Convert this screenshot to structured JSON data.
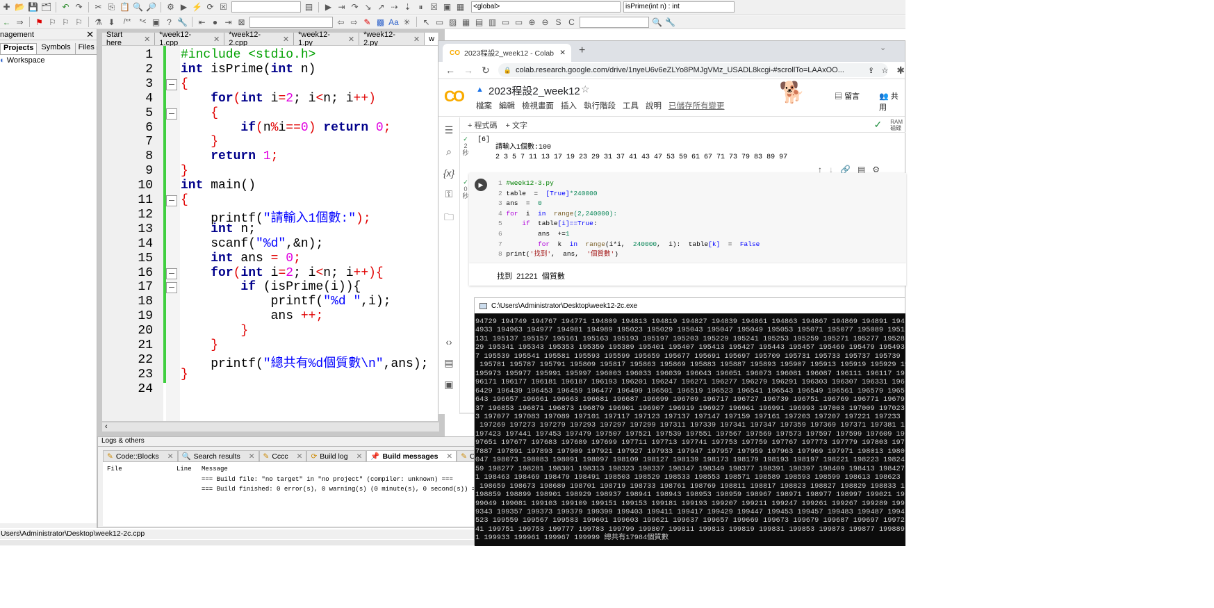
{
  "toolbar": {
    "scope_combo": "<global>",
    "function_combo": "isPrime(int n) : int"
  },
  "management": {
    "title": "nagement",
    "tabs": [
      "Projects",
      "Symbols",
      "Files"
    ],
    "tree_root": "Workspace"
  },
  "editor": {
    "tabs": [
      "Start here",
      "*week12-1.cpp",
      "*week12-2.cpp",
      "*week12-1.py",
      "*week12-2.py",
      "w"
    ],
    "lines": [
      [
        [
          "#include <stdio.h>",
          "pp"
        ]
      ],
      [
        [
          "int",
          "kw"
        ],
        [
          " isPrime(",
          "tx"
        ],
        [
          "int",
          "kw"
        ],
        [
          " n)",
          "tx"
        ]
      ],
      [
        [
          "{",
          "op"
        ]
      ],
      [
        [
          "    ",
          "tx"
        ],
        [
          "for",
          "kw"
        ],
        [
          "(",
          "op"
        ],
        [
          "int",
          "kw"
        ],
        [
          " i",
          "tx"
        ],
        [
          "=",
          "op"
        ],
        [
          "2",
          "nu"
        ],
        [
          "; i",
          "tx"
        ],
        [
          "<",
          "op"
        ],
        [
          "n; i",
          "tx"
        ],
        [
          "++",
          "op"
        ],
        [
          ")",
          "op"
        ]
      ],
      [
        [
          "    {",
          "op"
        ]
      ],
      [
        [
          "        ",
          "tx"
        ],
        [
          "if",
          "kw"
        ],
        [
          "(",
          "op"
        ],
        [
          "n",
          "tx"
        ],
        [
          "%",
          "op"
        ],
        [
          "i",
          "tx"
        ],
        [
          "==",
          "op"
        ],
        [
          "0",
          "nu"
        ],
        [
          ") ",
          "op"
        ],
        [
          "return",
          "kw"
        ],
        [
          " 0",
          "nu"
        ],
        [
          ";",
          "op"
        ]
      ],
      [
        [
          "    }",
          "op"
        ]
      ],
      [
        [
          "    ",
          "tx"
        ],
        [
          "return",
          "kw"
        ],
        [
          " 1",
          "nu"
        ],
        [
          ";",
          "op"
        ]
      ],
      [
        [
          "}",
          "op"
        ]
      ],
      [
        [
          "int",
          "kw"
        ],
        [
          " main()",
          "tx"
        ]
      ],
      [
        [
          "{",
          "op"
        ]
      ],
      [
        [
          "    printf(",
          "tx"
        ],
        [
          "\"請輸入1個數:\"",
          "st"
        ],
        [
          ");",
          "op"
        ]
      ],
      [
        [
          "    ",
          "tx"
        ],
        [
          "int",
          "kw"
        ],
        [
          " n;",
          "tx"
        ]
      ],
      [
        [
          "    scanf(",
          "tx"
        ],
        [
          "\"%d\"",
          "st"
        ],
        [
          ",&n);",
          "tx"
        ]
      ],
      [
        [
          "    ",
          "tx"
        ],
        [
          "int",
          "kw"
        ],
        [
          " ans ",
          "tx"
        ],
        [
          "=",
          "op"
        ],
        [
          " 0",
          "nu"
        ],
        [
          ";",
          "op"
        ]
      ],
      [
        [
          "    ",
          "tx"
        ],
        [
          "for",
          "kw"
        ],
        [
          "(",
          "op"
        ],
        [
          "int",
          "kw"
        ],
        [
          " i",
          "tx"
        ],
        [
          "=",
          "op"
        ],
        [
          "2",
          "nu"
        ],
        [
          "; i",
          "tx"
        ],
        [
          "<",
          "op"
        ],
        [
          "n; i",
          "tx"
        ],
        [
          "++",
          "op"
        ],
        [
          "){",
          "op"
        ]
      ],
      [
        [
          "        ",
          "tx"
        ],
        [
          "if",
          "kw"
        ],
        [
          " (isPrime(i)){",
          "tx"
        ]
      ],
      [
        [
          "            printf(",
          "tx"
        ],
        [
          "\"%d \"",
          "st"
        ],
        [
          ",i);",
          "tx"
        ]
      ],
      [
        [
          "            ans ",
          "tx"
        ],
        [
          "++",
          "op"
        ],
        [
          ";",
          "op"
        ]
      ],
      [
        [
          "        }",
          "op"
        ]
      ],
      [
        [
          "    }",
          "op"
        ]
      ],
      [
        [
          "    printf(",
          "tx"
        ],
        [
          "\"總共有%d個質數\\n\"",
          "st"
        ],
        [
          ",ans);",
          "tx"
        ]
      ],
      [
        [
          "}",
          "op"
        ]
      ],
      []
    ],
    "fold_lines": [
      3,
      5,
      11,
      16,
      17
    ]
  },
  "logs": {
    "title": "Logs & others",
    "tabs": [
      "Code::Blocks",
      "Search results",
      "Cccc",
      "Build log",
      "Build messages",
      "CppChe"
    ],
    "columns": [
      "File",
      "Line",
      "Message"
    ],
    "messages": [
      "=== Build file: \"no target\" in \"no project\" (compiler: unknown) ===",
      "=== Build finished: 0 error(s), 0 warning(s) (0 minute(s), 0 second(s)) ==="
    ]
  },
  "statusbar": {
    "path": "Users\\Administrator\\Desktop\\week12-2c.cpp"
  },
  "browser": {
    "tab_title": "2023程設2_week12 - Colab",
    "url": "colab.research.google.com/drive/1nyeU6v6eZLYo8PMJgVMz_USADL8kcgi-#scrollTo=LAAxOO...",
    "notebook_title": "2023程設2_week12",
    "menu": [
      "檔案",
      "編輯",
      "檢視畫面",
      "插入",
      "執行階段",
      "工具",
      "說明"
    ],
    "saved_status": "已儲存所有變更",
    "add_code": "+ 程式碼",
    "add_text": "+ 文字",
    "comment": "留言",
    "share": "共用",
    "ram": "RAM",
    "disk": "磁碟",
    "cell1": {
      "exec": "[6]",
      "time": "2",
      "unit": "秒",
      "output": [
        "請輸入1個數:100",
        "2 3 5 7 11 13 17 19 23 29 31 37 41 43 47 53 59 61 67 71 73 79 83 89 97"
      ]
    },
    "cell2": {
      "time": "0",
      "unit": "秒",
      "output": "找到  21221  個質數",
      "lines": [
        [
          [
            "#week12-3.py",
            "pyg"
          ]
        ],
        [
          [
            "table  =  ",
            "pyt"
          ],
          [
            "[True]",
            "pyc"
          ],
          [
            "*240000",
            "pyn"
          ]
        ],
        [
          [
            "ans  =  ",
            "pyt"
          ],
          [
            "0",
            "pyn"
          ]
        ],
        [
          [
            "for",
            "pyk"
          ],
          [
            "  i  ",
            "pyt"
          ],
          [
            "in",
            "pyc"
          ],
          [
            "  range",
            "pyb"
          ],
          [
            "(2,240000):",
            "pyn"
          ]
        ],
        [
          [
            "    ",
            "pyt"
          ],
          [
            "if",
            "pyk"
          ],
          [
            "  table",
            "pyt"
          ],
          [
            "[i]",
            "pyc"
          ],
          [
            "==True",
            "pyc"
          ],
          [
            ":",
            "pyt"
          ]
        ],
        [
          [
            "        ans  +=",
            "pyt"
          ],
          [
            "1",
            "pyn"
          ]
        ],
        [
          [
            "        ",
            "pyt"
          ],
          [
            "for",
            "pyk"
          ],
          [
            "  k  ",
            "pyt"
          ],
          [
            "in",
            "pyc"
          ],
          [
            "  range",
            "pyb"
          ],
          [
            "(i*i,  ",
            "pyt"
          ],
          [
            "240000",
            "pyn"
          ],
          [
            ",  i):  table",
            "pyt"
          ],
          [
            "[k]",
            "pyc"
          ],
          [
            "  =  ",
            "pyt"
          ],
          [
            "False",
            "pyc"
          ]
        ],
        [
          [
            "print(",
            "pyt"
          ],
          [
            "'找到'",
            "pys"
          ],
          [
            ",  ans,  ",
            "pyt"
          ],
          [
            "'個質數'",
            "pys"
          ],
          [
            ")",
            "pyt"
          ]
        ]
      ]
    }
  },
  "console": {
    "title": "C:\\Users\\Administrator\\Desktop\\week12-2c.exe",
    "lines": [
      "94729 194749 194767 194771 194809 194813 194819 194827 194839 194861 194863 194867 194869 194891 194",
      "4933 194963 194977 194981 194989 195023 195029 195043 195047 195049 195053 195071 195077 195089 1951",
      "131 195137 195157 195161 195163 195193 195197 195203 195229 195241 195253 195259 195271 195277 19528",
      "29 195341 195343 195353 195359 195389 195401 195407 195413 195427 195443 195457 195469 195479 195493",
      "7 195539 195541 195581 195593 195599 195659 195677 195691 195697 195709 195731 195733 195737 195739",
      " 195781 195787 195791 195809 195817 195863 195869 195883 195887 195893 195907 195913 195919 195929 19",
      "195973 195977 195991 195997 196003 196033 196039 196043 196051 196073 196081 196087 196111 196117 19",
      "96171 196177 196181 196187 196193 196201 196247 196271 196277 196279 196291 196303 196307 196331 196",
      "6429 196439 196453 196459 196477 196499 196501 196519 196523 196541 196543 196549 196561 196579 1965",
      "643 196657 196661 196663 196681 196687 196699 196709 196717 196727 196739 196751 196769 196771 19679",
      "37 196853 196871 196873 196879 196901 196907 196919 196927 196961 196991 196993 197003 197009 197023",
      "3 197077 197083 197089 197101 197117 197123 197137 197147 197159 197161 197203 197207 197221 197233",
      " 197269 197273 197279 197293 197297 197299 197311 197339 197341 197347 197359 197369 197371 197381 1",
      "197423 197441 197453 197479 197507 197521 197539 197551 197567 197569 197573 197597 197599 197609 19",
      "97651 197677 197683 197689 197699 197711 197713 197741 197753 197759 197767 197773 197779 197803 197",
      "7887 197891 197893 197909 197921 197927 197933 197947 197957 197959 197963 197969 197971 198013 1980",
      "047 198073 198083 198091 198097 198109 198127 198139 198173 198179 198193 198197 198221 198223 19824",
      "59 198277 198281 198301 198313 198323 198337 198347 198349 198377 198391 198397 198409 198413 198427",
      "1 198463 198469 198479 198491 198503 198529 198533 198553 198571 198589 198593 198599 198613 198623",
      " 198659 198673 198689 198701 198719 198733 198761 198769 198811 198817 198823 198827 198829 198833 1",
      "198859 198899 198901 198929 198937 198941 198943 198953 198959 198967 198971 198977 198997 199021 19",
      "99049 199081 199103 199109 199151 199153 199181 199193 199207 199211 199247 199261 199267 199289 199",
      "9343 199357 199373 199379 199399 199403 199411 199417 199429 199447 199453 199457 199483 199487 1994",
      "523 199559 199567 199583 199601 199603 199621 199637 199657 199669 199673 199679 199687 199697 19972",
      "41 199751 199753 199777 199783 199799 199807 199811 199813 199819 199831 199853 199873 199877 199889",
      "1 199933 199961 199967 199999 總共有17984個質數"
    ]
  }
}
